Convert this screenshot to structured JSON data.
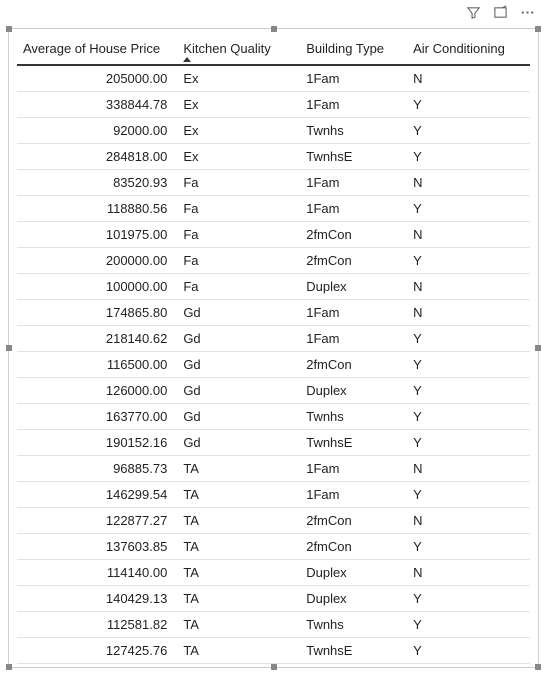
{
  "toolbar": {
    "filter_tooltip": "Filter",
    "focus_tooltip": "Focus mode",
    "more_tooltip": "More options"
  },
  "table": {
    "columns": [
      {
        "label": "Average of House Price",
        "align": "right",
        "sorted": false
      },
      {
        "label": "Kitchen Quality",
        "align": "left",
        "sorted": true
      },
      {
        "label": "Building Type",
        "align": "left",
        "sorted": false
      },
      {
        "label": "Air Conditioning",
        "align": "left",
        "sorted": false
      }
    ],
    "rows": [
      [
        "205000.00",
        "Ex",
        "1Fam",
        "N"
      ],
      [
        "338844.78",
        "Ex",
        "1Fam",
        "Y"
      ],
      [
        "92000.00",
        "Ex",
        "Twnhs",
        "Y"
      ],
      [
        "284818.00",
        "Ex",
        "TwnhsE",
        "Y"
      ],
      [
        "83520.93",
        "Fa",
        "1Fam",
        "N"
      ],
      [
        "118880.56",
        "Fa",
        "1Fam",
        "Y"
      ],
      [
        "101975.00",
        "Fa",
        "2fmCon",
        "N"
      ],
      [
        "200000.00",
        "Fa",
        "2fmCon",
        "Y"
      ],
      [
        "100000.00",
        "Fa",
        "Duplex",
        "N"
      ],
      [
        "174865.80",
        "Gd",
        "1Fam",
        "N"
      ],
      [
        "218140.62",
        "Gd",
        "1Fam",
        "Y"
      ],
      [
        "116500.00",
        "Gd",
        "2fmCon",
        "Y"
      ],
      [
        "126000.00",
        "Gd",
        "Duplex",
        "Y"
      ],
      [
        "163770.00",
        "Gd",
        "Twnhs",
        "Y"
      ],
      [
        "190152.16",
        "Gd",
        "TwnhsE",
        "Y"
      ],
      [
        "96885.73",
        "TA",
        "1Fam",
        "N"
      ],
      [
        "146299.54",
        "TA",
        "1Fam",
        "Y"
      ],
      [
        "122877.27",
        "TA",
        "2fmCon",
        "N"
      ],
      [
        "137603.85",
        "TA",
        "2fmCon",
        "Y"
      ],
      [
        "114140.00",
        "TA",
        "Duplex",
        "N"
      ],
      [
        "140429.13",
        "TA",
        "Duplex",
        "Y"
      ],
      [
        "112581.82",
        "TA",
        "Twnhs",
        "Y"
      ],
      [
        "127425.76",
        "TA",
        "TwnhsE",
        "Y"
      ]
    ]
  }
}
